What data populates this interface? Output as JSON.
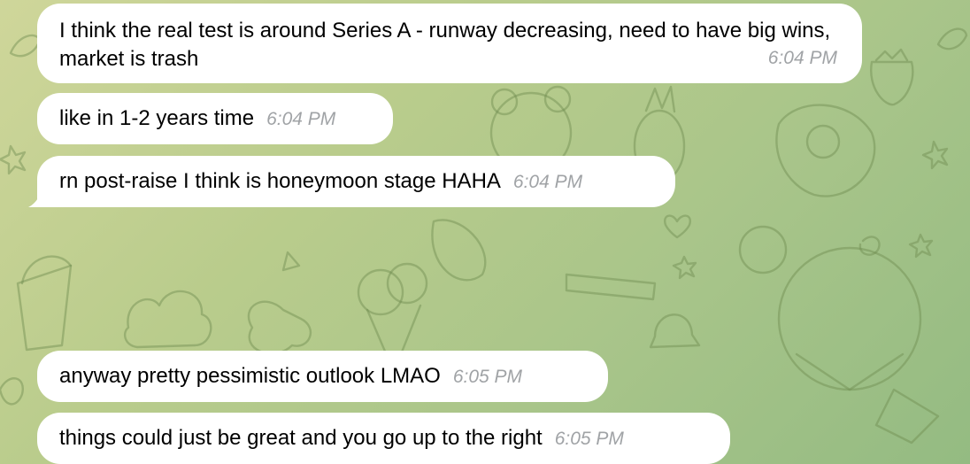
{
  "messages": [
    {
      "text": "I think the real test is around Series A - runway decreasing, need to have big wins, market is trash",
      "time": "6:04 PM"
    },
    {
      "text": "like in 1-2 years time",
      "time": "6:04 PM"
    },
    {
      "text": "rn post-raise I think is honeymoon stage HAHA",
      "time": "6:04 PM"
    },
    {
      "text": "anyway pretty pessimistic outlook LMAO",
      "time": "6:05 PM"
    },
    {
      "text": "things could just be great and you go up to the right",
      "time": "6:05 PM"
    }
  ],
  "colors": {
    "bubble": "#ffffff",
    "timestamp": "#a0a3a6",
    "wallpaper": "#b9cc8c"
  }
}
